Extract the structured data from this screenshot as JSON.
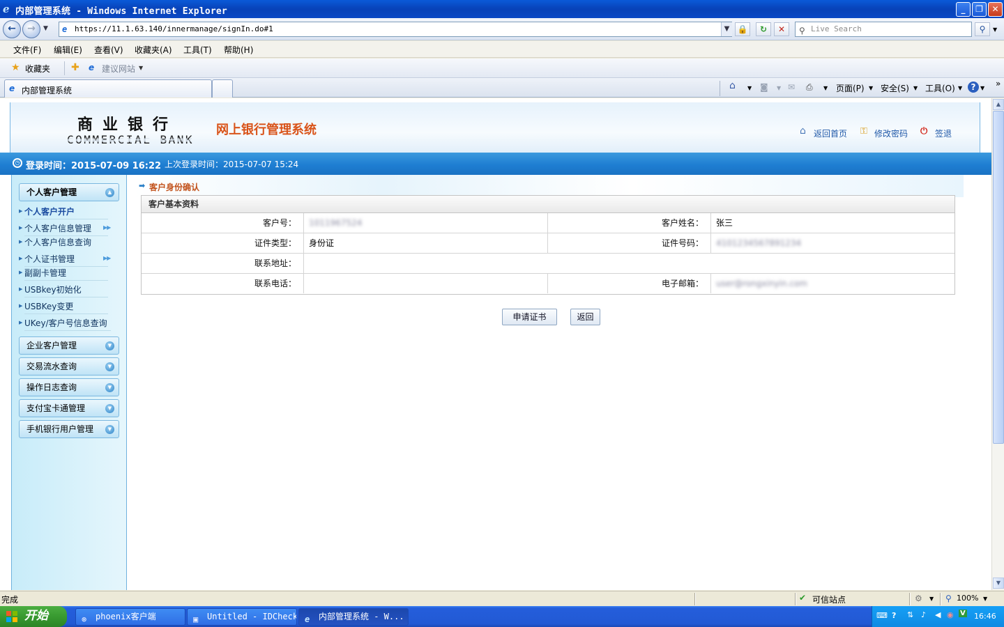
{
  "window": {
    "title": "内部管理系统 - Windows Internet Explorer"
  },
  "nav": {
    "url": "https://11.1.63.140/innermanage/signIn.do#1",
    "search_placeholder": "Live Search"
  },
  "menu": [
    "文件(F)",
    "编辑(E)",
    "查看(V)",
    "收藏夹(A)",
    "工具(T)",
    "帮助(H)"
  ],
  "favbar": {
    "favorites": "收藏夹",
    "suggested": "建议网站"
  },
  "tab": {
    "label": "内部管理系统"
  },
  "commandbar": {
    "page": "页面(P)",
    "safety": "安全(S)",
    "tools": "工具(O)"
  },
  "header": {
    "bank_cn": "商业银行",
    "bank_en": "COMMERCIAL BANK",
    "system_title": "网上银行管理系统",
    "links": {
      "home": "返回首页",
      "change_password": "修改密码",
      "logout": "签退"
    }
  },
  "loginbar": {
    "login_time": "登录时间：2015-07-09 16:22",
    "last_login": "上次登录时间：2015-07-07 15:24"
  },
  "sidebar": {
    "groups": [
      {
        "label": "个人客户管理",
        "expanded": true
      },
      {
        "label": "企业客户管理",
        "expanded": false
      },
      {
        "label": "交易流水查询",
        "expanded": false
      },
      {
        "label": "操作日志查询",
        "expanded": false
      },
      {
        "label": "支付宝卡通管理",
        "expanded": false
      },
      {
        "label": "手机银行用户管理",
        "expanded": false
      }
    ],
    "items": [
      {
        "label": "个人客户开户",
        "active": true
      },
      {
        "label": "个人客户信息管理",
        "has_sub": true
      },
      {
        "label": "个人客户信息查询"
      },
      {
        "label": "个人证书管理",
        "has_sub": true
      },
      {
        "label": "副副卡管理"
      },
      {
        "label": "USBkey初始化"
      },
      {
        "label": "USBKey变更"
      },
      {
        "label": "UKey/客户号信息查询"
      }
    ]
  },
  "main": {
    "breadcrumb": "客户身份确认",
    "section_title": "客户基本资料",
    "fields": {
      "customer_no_label": "客户号：",
      "customer_no_value": "1011967524",
      "customer_name_label": "客户姓名：",
      "customer_name_value": "张三",
      "id_type_label": "证件类型：",
      "id_type_value": "身份证",
      "id_no_label": "证件号码：",
      "id_no_value": "4101234567891234",
      "address_label": "联系地址：",
      "address_value": "",
      "phone_label": "联系电话：",
      "phone_value": "",
      "email_label": "电子邮箱：",
      "email_value": "user@rongxinyin.com"
    },
    "buttons": {
      "apply_cert": "申请证书",
      "back": "返回"
    }
  },
  "statusbar": {
    "status": "完成",
    "zone": "可信站点",
    "zoom": "100%"
  },
  "taskbar": {
    "start": "开始",
    "tasks": [
      {
        "label": "phoenix客户端"
      },
      {
        "label": "Untitled - IDCheck"
      },
      {
        "label": "内部管理系统 - W..."
      }
    ],
    "clock": "16:46"
  },
  "colors": {
    "accent_orange": "#d9541a",
    "header_blue": "#1e7ed2",
    "link_blue": "#1f58a8"
  }
}
